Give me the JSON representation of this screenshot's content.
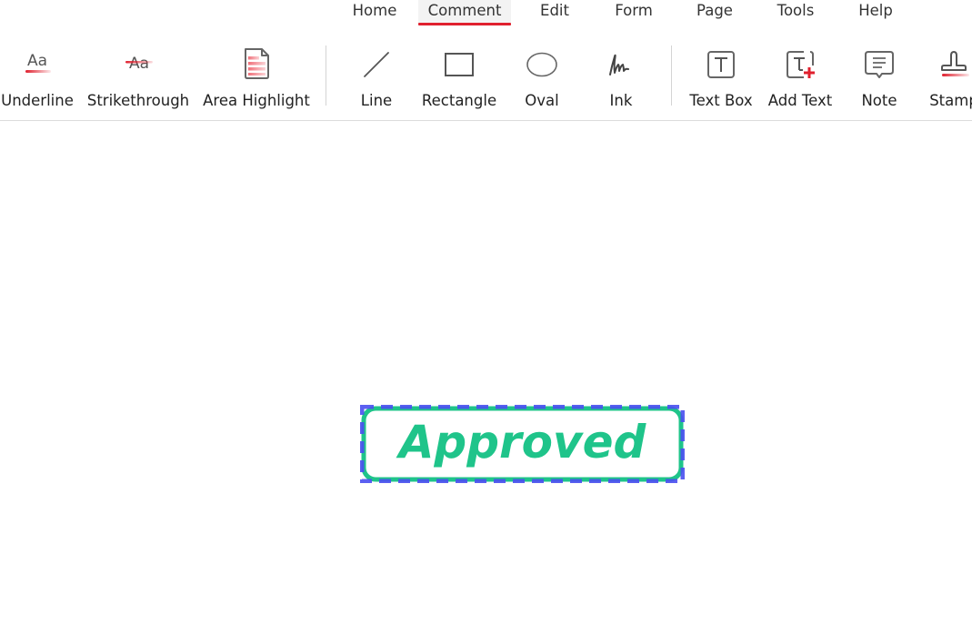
{
  "menu": {
    "tabs": [
      {
        "label": "Home",
        "active": false
      },
      {
        "label": "Comment",
        "active": true
      },
      {
        "label": "Edit",
        "active": false
      },
      {
        "label": "Form",
        "active": false
      },
      {
        "label": "Page",
        "active": false
      },
      {
        "label": "Tools",
        "active": false
      },
      {
        "label": "Help",
        "active": false
      }
    ]
  },
  "ribbon": {
    "tools": [
      {
        "label": "Underline",
        "icon": "underline-icon"
      },
      {
        "label": "Strikethrough",
        "icon": "strikethrough-icon"
      },
      {
        "label": "Area Highlight",
        "icon": "area-highlight-icon"
      },
      {
        "label": "Line",
        "icon": "line-icon"
      },
      {
        "label": "Rectangle",
        "icon": "rectangle-icon"
      },
      {
        "label": "Oval",
        "icon": "oval-icon"
      },
      {
        "label": "Ink",
        "icon": "ink-icon"
      },
      {
        "label": "Text Box",
        "icon": "text-box-icon"
      },
      {
        "label": "Add Text",
        "icon": "add-text-icon"
      },
      {
        "label": "Note",
        "icon": "note-icon"
      },
      {
        "label": "Stamp",
        "icon": "stamp-icon"
      }
    ],
    "icon_glyph_text": "Aa"
  },
  "document": {
    "stamp": {
      "text": "Approved",
      "text_color": "#1fc48a",
      "border_color": "#1fc48a",
      "selection_color": "#4a4ff0",
      "selected": true
    }
  },
  "colors": {
    "accent": "#e0202e",
    "icon_gray": "#555555"
  }
}
